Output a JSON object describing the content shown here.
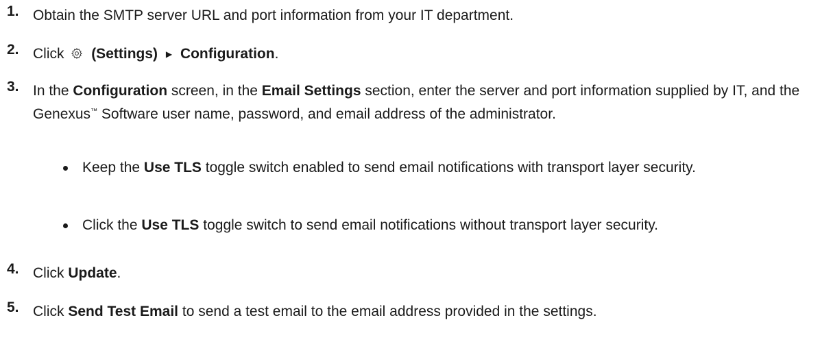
{
  "steps": [
    {
      "number": "1.",
      "text": "Obtain the SMTP server URL and port information from your IT department."
    },
    {
      "number": "2.",
      "pre": "Click",
      "settings_label": "(Settings)",
      "config_label": "Configuration",
      "post": "."
    },
    {
      "number": "3.",
      "pre": "In the",
      "screen_bold": "Configuration",
      "mid1": "screen, in the",
      "section_bold": "Email Settings",
      "mid2": "section, enter the server and port information supplied by IT, and the Genexus",
      "tm": "™",
      "post": "Software user name, password, and email address of the administrator.",
      "bullets": [
        {
          "pre": "Keep the",
          "bold": "Use TLS",
          "post": "toggle switch enabled to send email notifications with transport layer security."
        },
        {
          "pre": "Click the",
          "bold": "Use TLS",
          "post": "toggle switch to send email notifications without transport layer security."
        }
      ]
    },
    {
      "number": "4.",
      "pre": "Click",
      "bold": "Update",
      "post": "."
    },
    {
      "number": "5.",
      "pre": "Click",
      "bold": "Send Test Email",
      "post": "to send a test email to the email address provided in the settings."
    }
  ],
  "icons": {
    "settings": "gear-icon",
    "arrow": "triangle-right-icon"
  }
}
